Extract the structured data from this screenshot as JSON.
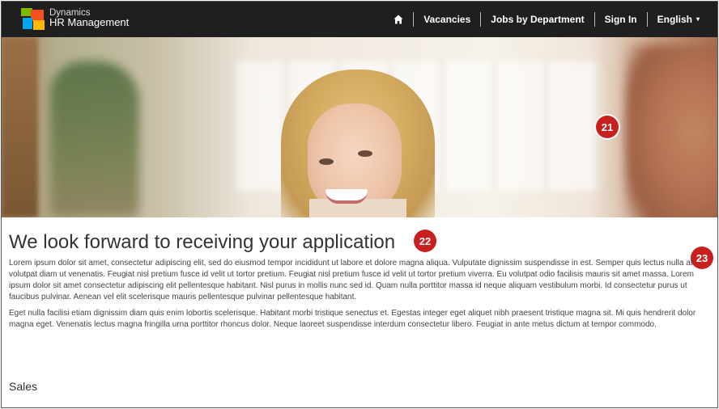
{
  "brand": {
    "line1": "Dynamics",
    "line2": "HR Management"
  },
  "nav": {
    "home_icon": "home-icon",
    "items": [
      "Vacancies",
      "Jobs by Department",
      "Sign In",
      "English"
    ],
    "language_caret": "▾"
  },
  "colors": {
    "topbar": "#1f1f1f",
    "callout": "#c8201e",
    "logo_orange": "#f25022",
    "logo_green": "#7fba00",
    "logo_blue": "#00a4ef",
    "logo_yellow": "#ffb900"
  },
  "callouts": [
    "21",
    "22",
    "23"
  ],
  "content": {
    "title": "We look forward to receiving your application",
    "paragraph1": "Lorem ipsum dolor sit amet, consectetur adipiscing elit, sed do eiusmod tempor incididunt ut labore et dolore magna aliqua. Vulputate dignissim suspendisse in est. Semper quis lectus nulla at volutpat diam ut venenatis. Feugiat nisl pretium fusce id velit ut tortor pretium. Feugiat nisl pretium fusce id velit ut tortor pretium viverra. Eu volutpat odio facilisis mauris sit amet massa. Lorem ipsum dolor sit amet consectetur adipiscing elit pellentesque habitant. Nisl purus in mollis nunc sed id. Quam nulla porttitor massa id neque aliquam vestibulum morbi. Id consectetur purus ut faucibus pulvinar. Aenean vel elit scelerisque mauris pellentesque pulvinar pellentesque habitant.",
    "paragraph2": "Eget nulla facilisi etiam dignissim diam quis enim lobortis scelerisque. Habitant morbi tristique senectus et. Egestas integer eget aliquet nibh praesent tristique magna sit. Mi quis hendrerit dolor magna eget. Venenatis lectus magna fringilla urna porttitor rhoncus dolor. Neque laoreet suspendisse interdum consectetur libero. Feugiat in ante metus dictum at tempor commodo.",
    "section_heading": "Sales"
  }
}
